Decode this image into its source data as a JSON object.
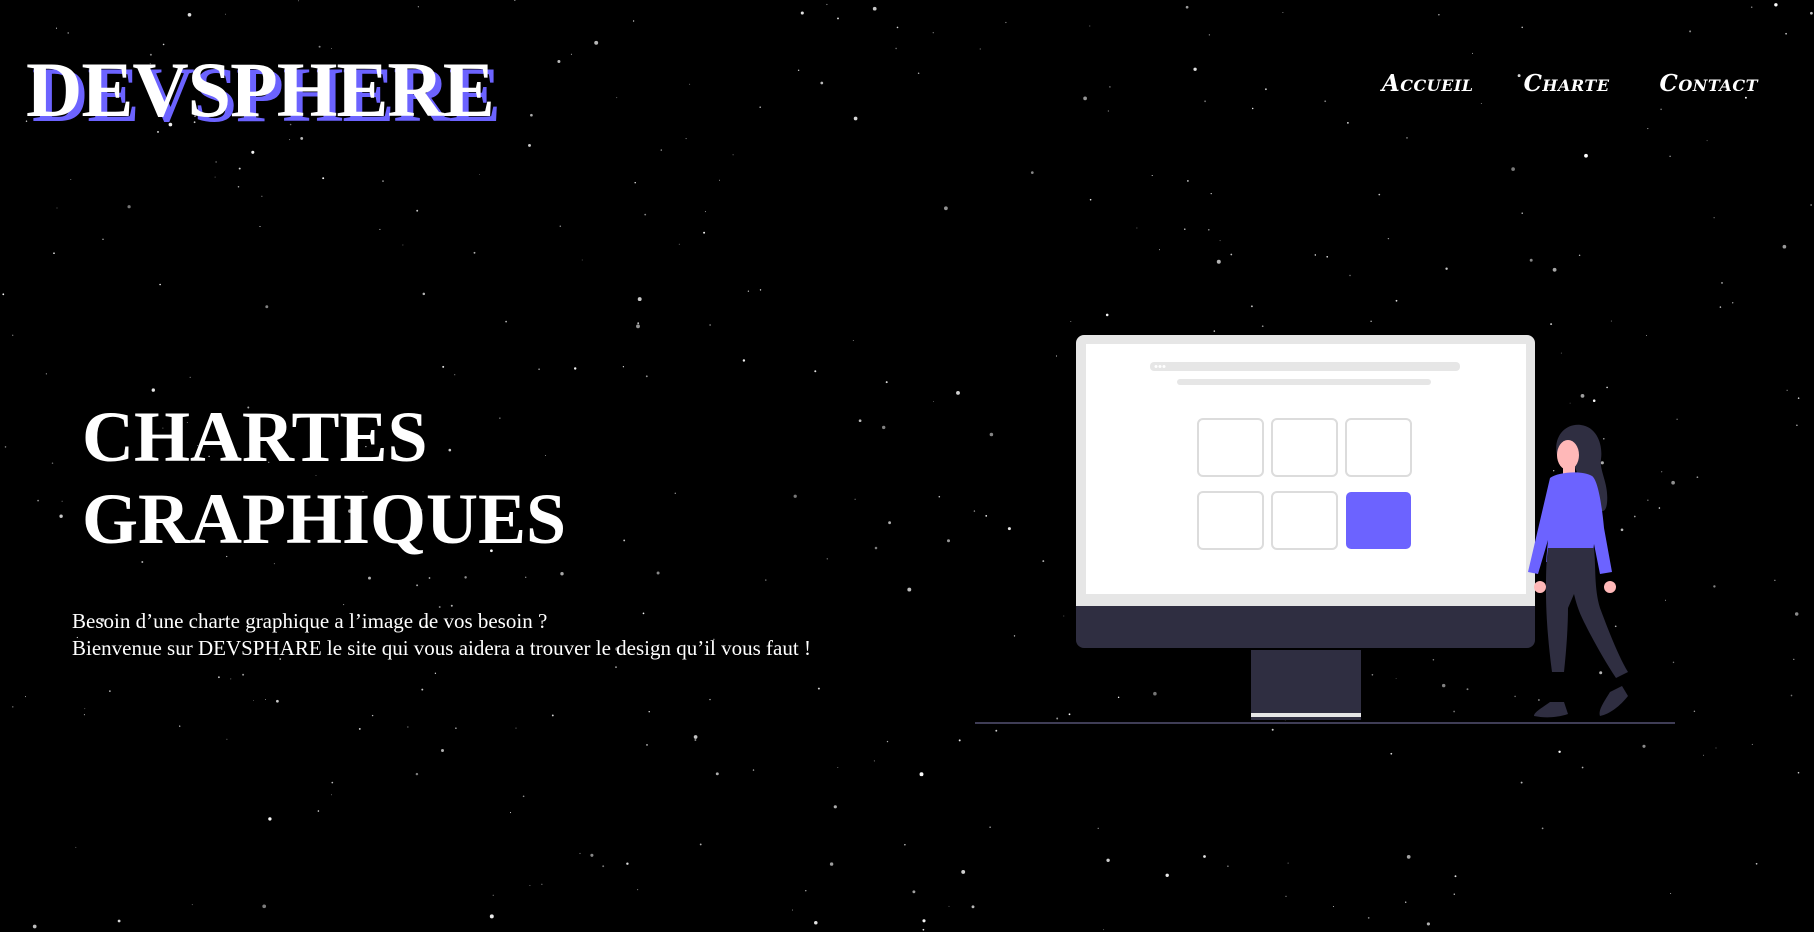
{
  "header": {
    "logo": "DEVSPHERE",
    "nav": [
      "Accueil",
      "Charte",
      "Contact"
    ]
  },
  "hero": {
    "title_line1": "CHARTES",
    "title_line2": "GRAPHIQUES",
    "text_line1": "Besoin d’une charte graphique a l’image de vos besoin ?",
    "text_line2": "Bienvenue sur DEVSPHARE le site qui vous aidera a trouver le design qu’il vous faut !"
  },
  "colors": {
    "background": "#000000",
    "accent": "#6c63ff",
    "text": "#ffffff",
    "dark_figure": "#2f2e41"
  },
  "icons": {
    "illustration": "person-next-to-monitor-illustration",
    "background": "starfield"
  }
}
